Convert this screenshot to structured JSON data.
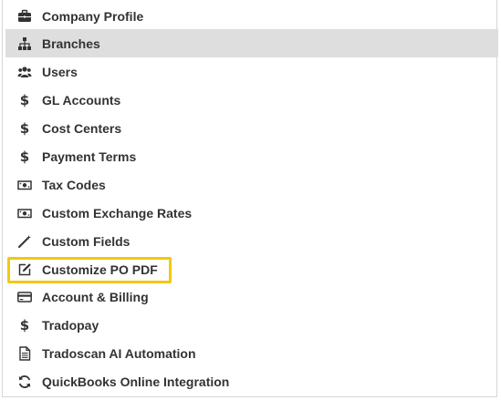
{
  "menu": {
    "items": [
      {
        "label": "Company Profile",
        "icon": "briefcase-icon"
      },
      {
        "label": "Branches",
        "icon": "sitemap-icon",
        "active": true
      },
      {
        "label": "Users",
        "icon": "users-icon"
      },
      {
        "label": "GL Accounts",
        "icon": "dollar-icon"
      },
      {
        "label": "Cost Centers",
        "icon": "dollar-icon"
      },
      {
        "label": "Payment Terms",
        "icon": "dollar-icon"
      },
      {
        "label": "Tax Codes",
        "icon": "money-bill-icon"
      },
      {
        "label": "Custom Exchange Rates",
        "icon": "money-bill-icon"
      },
      {
        "label": "Custom Fields",
        "icon": "magic-wand-icon"
      },
      {
        "label": "Customize PO PDF",
        "icon": "edit-icon",
        "highlighted": true
      },
      {
        "label": "Account & Billing",
        "icon": "credit-card-icon"
      },
      {
        "label": "Tradopay",
        "icon": "dollar-icon"
      },
      {
        "label": "Tradoscan AI Automation",
        "icon": "file-text-icon"
      },
      {
        "label": "QuickBooks Online Integration",
        "icon": "sync-icon"
      }
    ]
  },
  "colors": {
    "active_background": "#dedede",
    "highlight_border": "#f2c811",
    "text": "#333333"
  }
}
